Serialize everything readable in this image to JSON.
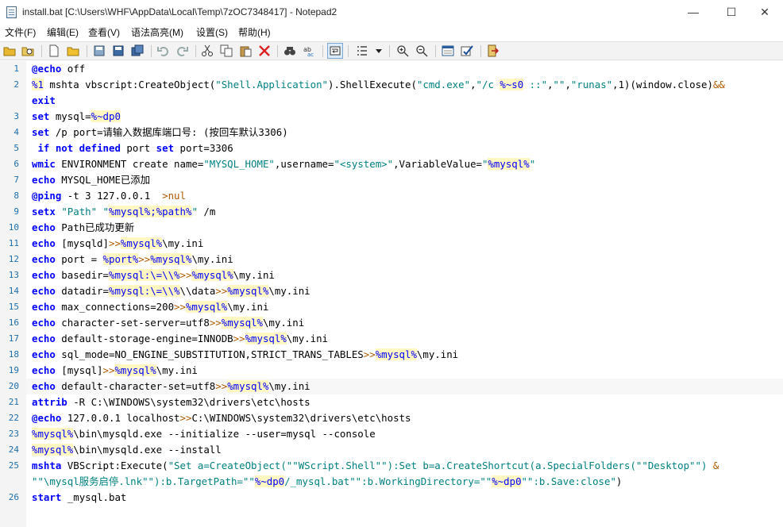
{
  "window": {
    "title": "install.bat [C:\\Users\\WHF\\AppData\\Local\\Temp\\7zOC7348417] - Notepad2",
    "min_glyph": "—",
    "max_glyph": "☐",
    "close_glyph": "✕"
  },
  "menu": [
    "文件(F)",
    "编辑(E)",
    "查看(V)",
    "语法高亮(M)",
    "设置(S)",
    "帮助(H)"
  ],
  "toolbar": {
    "icons": [
      "open-folder-icon",
      "browse-icon",
      "new-file-icon",
      "open-file-icon",
      "save-icon",
      "save-as-icon",
      "save-copy-icon",
      "undo-icon",
      "redo-icon",
      "cut-icon",
      "copy-icon",
      "paste-icon",
      "delete-icon",
      "find-icon",
      "replace-icon",
      "word-wrap-icon",
      "list-icon",
      "dropdown-icon",
      "zoom-in-icon",
      "zoom-out-icon",
      "schemes-icon",
      "customize-icon",
      "exit-icon"
    ]
  },
  "colors": {
    "keyword": "#0000ff",
    "string": "#008080",
    "variable_bg": "#fff7c2",
    "line_number": "#1f6fb0"
  },
  "editor": {
    "line_numbers": [
      "1",
      "2",
      "3",
      "4",
      "5",
      "6",
      "7",
      "8",
      "9",
      "10",
      "11",
      "12",
      "13",
      "14",
      "15",
      "16",
      "17",
      "18",
      "19",
      "20",
      "21",
      "22",
      "23",
      "24",
      "25",
      "26"
    ],
    "lines": [
      [
        {
          "t": "@echo",
          "c": "kw"
        },
        {
          "t": " off"
        }
      ],
      [
        {
          "t": "%1",
          "c": "var"
        },
        {
          "t": " mshta vbscript:CreateObject("
        },
        {
          "t": "\"Shell.Application\"",
          "c": "str"
        },
        {
          "t": ").ShellExecute("
        },
        {
          "t": "\"cmd.exe\"",
          "c": "str"
        },
        {
          "t": ","
        },
        {
          "t": "\"/c ",
          "c": "str"
        },
        {
          "t": "%~s0",
          "c": "var"
        },
        {
          "t": " ::\"",
          "c": "str"
        },
        {
          "t": ","
        },
        {
          "t": "\"\"",
          "c": "str"
        },
        {
          "t": ","
        },
        {
          "t": "\"runas\"",
          "c": "str"
        },
        {
          "t": ",1)(window.close)"
        },
        {
          "t": "&&",
          "c": "op"
        }
      ],
      [
        {
          "t": "exit",
          "c": "kw"
        }
      ],
      [
        {
          "t": "set",
          "c": "kw"
        },
        {
          "t": " mysql="
        },
        {
          "t": "%~dp0",
          "c": "var"
        }
      ],
      [
        {
          "t": "set",
          "c": "kw"
        },
        {
          "t": " /p port=请输入数据库端口号: (按回车默认3306)"
        }
      ],
      [
        {
          "t": " "
        },
        {
          "t": "if not defined",
          "c": "kw"
        },
        {
          "t": " port "
        },
        {
          "t": "set",
          "c": "kw"
        },
        {
          "t": " port=3306"
        }
      ],
      [
        {
          "t": "wmic",
          "c": "kw"
        },
        {
          "t": " ENVIRONMENT create name="
        },
        {
          "t": "\"MYSQL_HOME\"",
          "c": "str"
        },
        {
          "t": ",username="
        },
        {
          "t": "\"<system>\"",
          "c": "str"
        },
        {
          "t": ",VariableValue="
        },
        {
          "t": "\"",
          "c": "str"
        },
        {
          "t": "%mysql%",
          "c": "var"
        },
        {
          "t": "\"",
          "c": "str"
        }
      ],
      [
        {
          "t": "echo",
          "c": "kw"
        },
        {
          "t": " MYSQL_HOME已添加"
        }
      ],
      [
        {
          "t": "@ping",
          "c": "kw"
        },
        {
          "t": " -t 3 127.0.0.1  "
        },
        {
          "t": ">nul",
          "c": "op"
        }
      ],
      [
        {
          "t": "setx",
          "c": "kw"
        },
        {
          "t": " "
        },
        {
          "t": "\"Path\"",
          "c": "str"
        },
        {
          "t": " "
        },
        {
          "t": "\"",
          "c": "str"
        },
        {
          "t": "%mysql%;%path%",
          "c": "var"
        },
        {
          "t": "\"",
          "c": "str"
        },
        {
          "t": " /m"
        }
      ],
      [
        {
          "t": "echo",
          "c": "kw"
        },
        {
          "t": " Path已成功更新"
        }
      ],
      [
        {
          "t": "echo",
          "c": "kw"
        },
        {
          "t": " [mysqld]"
        },
        {
          "t": ">>",
          "c": "op"
        },
        {
          "t": "%mysql%",
          "c": "var"
        },
        {
          "t": "\\my.ini"
        }
      ],
      [
        {
          "t": "echo",
          "c": "kw"
        },
        {
          "t": " port = "
        },
        {
          "t": "%port%",
          "c": "var"
        },
        {
          "t": ">>",
          "c": "op"
        },
        {
          "t": "%mysql%",
          "c": "var"
        },
        {
          "t": "\\my.ini"
        }
      ],
      [
        {
          "t": "echo",
          "c": "kw"
        },
        {
          "t": " basedir="
        },
        {
          "t": "%mysql:\\=\\\\%",
          "c": "var"
        },
        {
          "t": ">>",
          "c": "op"
        },
        {
          "t": "%mysql%",
          "c": "var"
        },
        {
          "t": "\\my.ini"
        }
      ],
      [
        {
          "t": "echo",
          "c": "kw"
        },
        {
          "t": " datadir="
        },
        {
          "t": "%mysql:\\=\\\\%",
          "c": "var"
        },
        {
          "t": "\\\\data"
        },
        {
          "t": ">>",
          "c": "op"
        },
        {
          "t": "%mysql%",
          "c": "var"
        },
        {
          "t": "\\my.ini"
        }
      ],
      [
        {
          "t": "echo",
          "c": "kw"
        },
        {
          "t": " max_connections=200"
        },
        {
          "t": ">>",
          "c": "op"
        },
        {
          "t": "%mysql%",
          "c": "var"
        },
        {
          "t": "\\my.ini"
        }
      ],
      [
        {
          "t": "echo",
          "c": "kw"
        },
        {
          "t": " character-set-server=utf8"
        },
        {
          "t": ">>",
          "c": "op"
        },
        {
          "t": "%mysql%",
          "c": "var"
        },
        {
          "t": "\\my.ini"
        }
      ],
      [
        {
          "t": "echo",
          "c": "kw"
        },
        {
          "t": " default-storage-engine=INNODB"
        },
        {
          "t": ">>",
          "c": "op"
        },
        {
          "t": "%mysql%",
          "c": "var"
        },
        {
          "t": "\\my.ini"
        }
      ],
      [
        {
          "t": "echo",
          "c": "kw"
        },
        {
          "t": " sql_mode=NO_ENGINE_SUBSTITUTION,STRICT_TRANS_TABLES"
        },
        {
          "t": ">>",
          "c": "op"
        },
        {
          "t": "%mysql%",
          "c": "var"
        },
        {
          "t": "\\my.ini"
        }
      ],
      [
        {
          "t": "echo",
          "c": "kw"
        },
        {
          "t": " [mysql]"
        },
        {
          "t": ">>",
          "c": "op"
        },
        {
          "t": "%mysql%",
          "c": "var"
        },
        {
          "t": "\\my.ini"
        }
      ],
      [
        {
          "t": "echo",
          "c": "kw"
        },
        {
          "t": " default-character-set=utf8"
        },
        {
          "t": ">>",
          "c": "op"
        },
        {
          "t": "%mysql%",
          "c": "var"
        },
        {
          "t": "\\my.ini"
        }
      ],
      [
        {
          "t": "attrib",
          "c": "kw"
        },
        {
          "t": " -R C:\\WINDOWS\\system32\\drivers\\etc\\hosts"
        }
      ],
      [
        {
          "t": "@echo",
          "c": "kw"
        },
        {
          "t": " 127.0.0.1 localhost"
        },
        {
          "t": ">>",
          "c": "op"
        },
        {
          "t": "C:\\WINDOWS\\system32\\drivers\\etc\\hosts"
        }
      ],
      [
        {
          "t": "%mysql%",
          "c": "var"
        },
        {
          "t": "\\bin\\mysqld.exe --initialize --user=mysql --console"
        }
      ],
      [
        {
          "t": "%mysql%",
          "c": "var"
        },
        {
          "t": "\\bin\\mysqld.exe --install"
        }
      ],
      [
        {
          "t": "mshta",
          "c": "kw"
        },
        {
          "t": " VBScript:Execute("
        },
        {
          "t": "\"Set a=CreateObject(\"\"WScript.Shell\"\"):Set b=a.CreateShortcut(a.SpecialFolders(\"\"Desktop\"\") ",
          "c": "str"
        },
        {
          "t": "&",
          "c": "op"
        }
      ],
      [
        {
          "t": "\"\"\\mysql服务启停.lnk\"\"):b.TargetPath=\"\"",
          "c": "str"
        },
        {
          "t": "%~dp0",
          "c": "var"
        },
        {
          "t": "/_mysql.bat\"\":b.WorkingDirectory=\"\"",
          "c": "str"
        },
        {
          "t": "%~dp0",
          "c": "var"
        },
        {
          "t": "\"\":b.Save:close\"",
          "c": "str"
        },
        {
          "t": ")"
        }
      ],
      [
        {
          "t": "start",
          "c": "kw"
        },
        {
          "t": " _mysql.bat"
        }
      ]
    ]
  }
}
